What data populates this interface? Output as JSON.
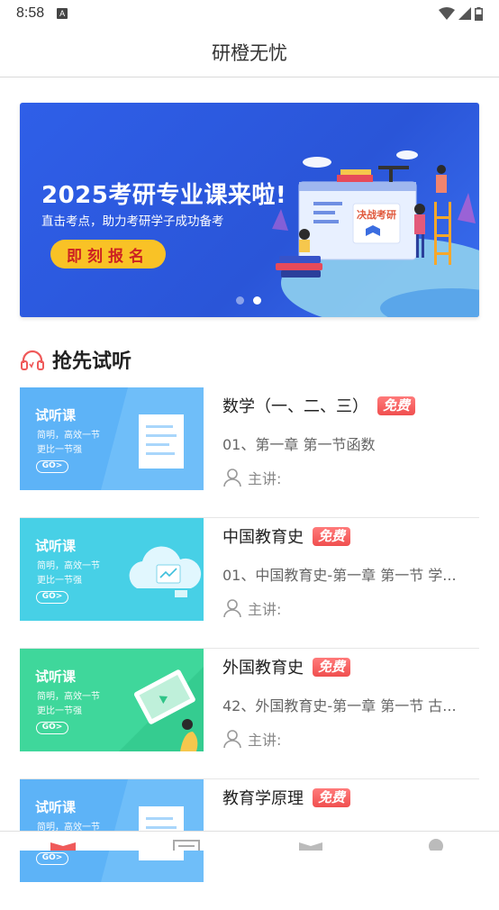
{
  "status": {
    "time": "8:58",
    "a_icon_letter": "A"
  },
  "header": {
    "title": "研橙无忧"
  },
  "banner": {
    "headline": "2025考研专业课来啦!",
    "subline": "直击考点，助力考研学子成功备考",
    "cta": "即刻报名",
    "board_text": "决战考研",
    "slides": 2,
    "active_slide": 2
  },
  "section": {
    "title": "抢先试听",
    "icon": "headphones-icon"
  },
  "thumb_common": {
    "t1": "试听课",
    "t2": "简明，高效一节",
    "t3": "更比一节强",
    "go": "GO>"
  },
  "courses": [
    {
      "name": "数学（一、二、三）",
      "badge": "免费",
      "lesson": "01、第一章 第一节函数",
      "teacher_label": "主讲:",
      "thumb_color": "#5db3f7"
    },
    {
      "name": "中国教育史",
      "badge": "免费",
      "lesson": "01、中国教育史-第一章 第一节 学...",
      "teacher_label": "主讲:",
      "thumb_color": "#47d0e6"
    },
    {
      "name": "外国教育史",
      "badge": "免费",
      "lesson": "42、外国教育史-第一章 第一节 古...",
      "teacher_label": "主讲:",
      "thumb_color": "#3fd79b"
    },
    {
      "name": "教育学原理",
      "badge": "免费",
      "lesson": "",
      "teacher_label": "",
      "thumb_color": "#5db3f7"
    }
  ],
  "colors": {
    "accent_red": "#f04f4f",
    "banner_blue": "#2f5fe8",
    "cta_yellow": "#f9c226"
  },
  "tabbar": {
    "icons": [
      "home-book-icon",
      "course-list-icon",
      "library-icon",
      "profile-icon"
    ]
  }
}
